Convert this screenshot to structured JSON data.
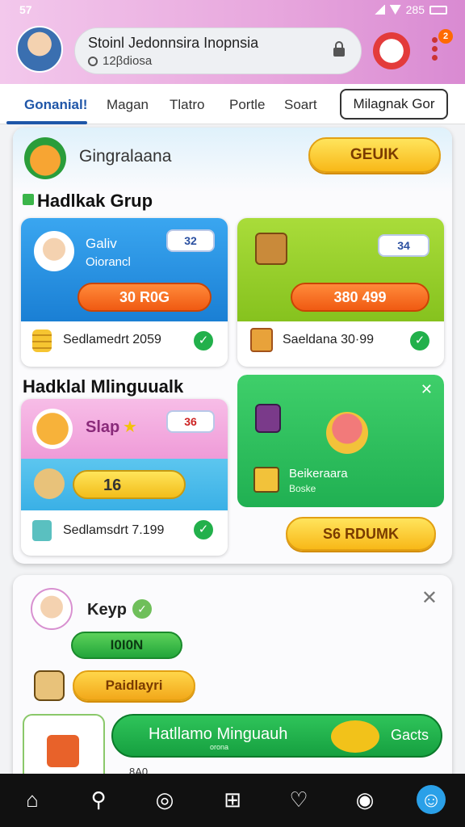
{
  "status_bar": {
    "time": "57",
    "battery": "285"
  },
  "header": {
    "title": "Stoinl Jedonnsira Inopnsia",
    "subtitle": "12βdiosa",
    "notification_count": "2"
  },
  "tabs": {
    "items": [
      "Gonanial!",
      "Magan",
      "Tlatro",
      "Portle",
      "Soart"
    ],
    "button_label": "Milagnak Gor"
  },
  "main_card": {
    "title": "Gingralaana",
    "header_button": "GEUIK",
    "section1_title": "Hadlkak Grup",
    "tile1": {
      "name": "Galiv",
      "role": "Oiorancl",
      "badge": "32",
      "price": "30 R0G",
      "footer": "Sedlamedrt 2059"
    },
    "tile2": {
      "badge": "34",
      "price": "380 499",
      "footer": "Saeldana 30·99"
    },
    "section2_title": "Hadklal Mlinguualk",
    "tile3": {
      "label": "Slap",
      "badge": "36",
      "coins": "16",
      "footer": "Sedlamsdrt 7.199"
    },
    "tile4": {
      "name": "Beikeraara",
      "sub": "Boske",
      "button": "S6 RDUMK"
    }
  },
  "card2": {
    "user": "Keyp",
    "green_button": "I0I0N",
    "orange_label": "Paidlayri",
    "banner_text": "Hatllamo Minguauh",
    "banner_sub": "orona",
    "banner_action": "Gacts",
    "partial_text": "8A0"
  },
  "colors": {
    "accent": "#1f56a8",
    "header_pink": "#e7a6dd",
    "nav_bg": "#111111"
  }
}
